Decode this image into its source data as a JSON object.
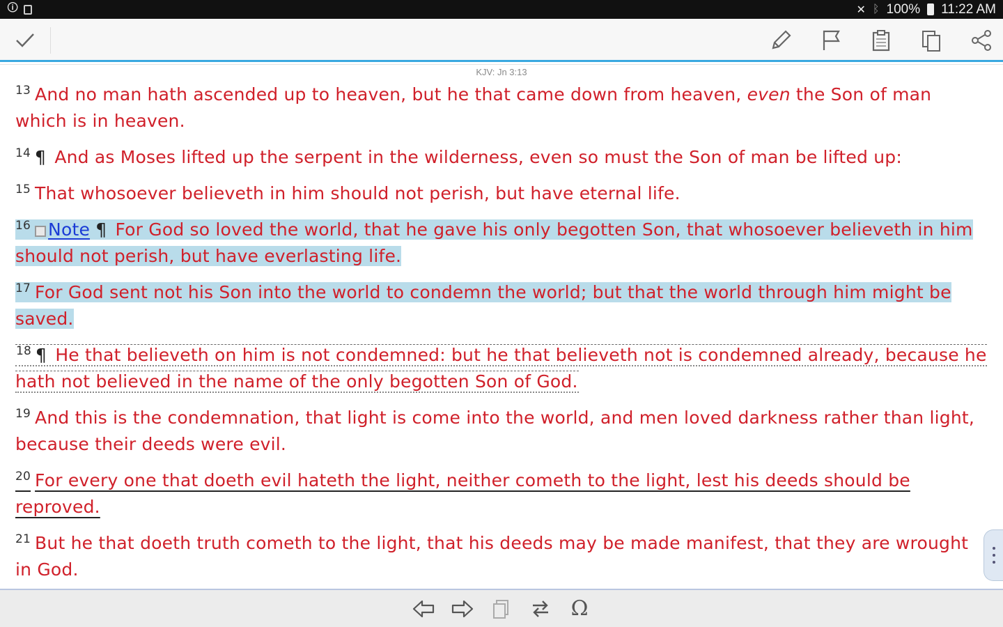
{
  "status_bar": {
    "battery": "100%",
    "time": "11:22 AM"
  },
  "toolbar": {
    "icons": [
      "check-icon",
      "pencil-icon",
      "flag-icon",
      "clipboard-icon",
      "copy-icon",
      "share-icon"
    ]
  },
  "reference": "KJV: Jn 3:13",
  "verses": [
    {
      "num": "13",
      "pre": "And no man hath ascended up to heaven, but he that came down from heaven, ",
      "italic": "even",
      "post": " the Son of man which is in heaven."
    },
    {
      "num": "14",
      "pilcrow": "¶",
      "text": "And as Moses lifted up the serpent in the wilderness, even so must the Son of man be lifted up:"
    },
    {
      "num": "15",
      "text": "That whosoever believeth in him should not perish, but have eternal life."
    },
    {
      "num": "16",
      "note_label": "Note",
      "pilcrow": "¶",
      "text": "For God so loved the world, that he gave his only begotten Son, that whosoever believeth in him should not perish, but have everlasting life."
    },
    {
      "num": "17",
      "text": "For God sent not his Son into the world to condemn the world; but that the world through him might be saved."
    },
    {
      "num": "18",
      "pilcrow": "¶",
      "text": "He that believeth on him is not condemned: but he that believeth not is condemned already, because he hath not believed in the name of the only begotten Son of God."
    },
    {
      "num": "19",
      "text": "And this is the condemnation, that light is come into the world, and men loved darkness rather than light, because their deeds were evil."
    },
    {
      "num": "20",
      "text": "For every one that doeth evil hateth the light, neither cometh to the light, lest his deeds should be reproved."
    },
    {
      "num": "21",
      "text": "But he that doeth truth cometh to the light, that his deeds may be made manifest, that they are wrought in God."
    }
  ],
  "colors": {
    "verse_text": "#d0202a",
    "highlight": "#b9dcea",
    "accent": "#3aa9e0",
    "link": "#1a3bd6"
  },
  "bottom_bar": {
    "omega_symbol": "Ω"
  }
}
